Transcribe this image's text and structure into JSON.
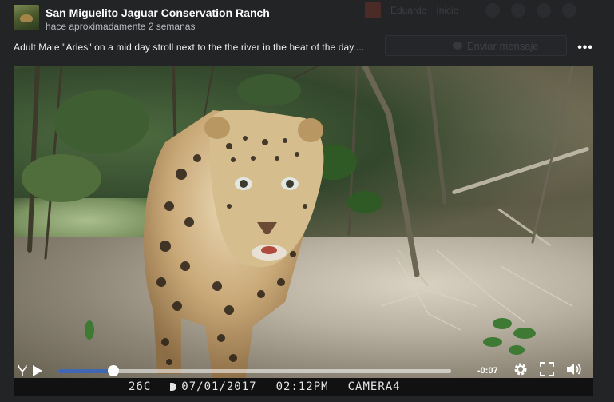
{
  "background": {
    "user_name": "Eduardo",
    "home_label": "Inicio",
    "message_button": "Enviar mensaje"
  },
  "post": {
    "page_name": "San Miguelito Jaguar Conservation Ranch",
    "timestamp": "hace aproximadamente 2 semanas",
    "caption": "Adult Male \"Aries\" on a mid day stroll next to the the river in the heat of the day....",
    "more_label": "•••"
  },
  "video": {
    "time_remaining": "-0:07",
    "progress": 0.14,
    "camera_stamp": {
      "temperature": "26C",
      "date": "07/01/2017",
      "time": "02:12PM",
      "camera": "CAMERA4"
    }
  },
  "icons": [
    "avatar-image",
    "more-options-icon",
    "antler-logo-icon",
    "play-icon",
    "settings-icon",
    "fullscreen-icon",
    "volume-icon",
    "moon-phase-icon"
  ],
  "colors": {
    "progress_accent": "#4267b2",
    "overlay_background": "#1c1d1f"
  }
}
